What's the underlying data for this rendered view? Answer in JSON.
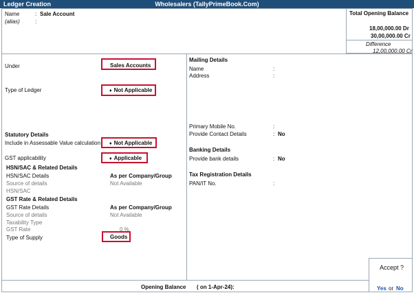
{
  "window": {
    "title": "Ledger Creation",
    "company": "Wholesalers (TallyPrimeBook.Com)"
  },
  "header": {
    "name_label": "Name",
    "name_value": "Sale Account",
    "alias_label": "(alias)"
  },
  "opening_panel": {
    "title": "Total Opening Balance",
    "debit": "18,00,000.00 Dr",
    "credit": "30,00,000.00 Cr",
    "difference_label": "Difference",
    "difference": "12,00,000.00 Cr"
  },
  "left": {
    "under_label": "Under",
    "under_value": "Sales Accounts",
    "type_label": "Type of Ledger",
    "type_value": "Not Applicable",
    "statutory_title": "Statutory Details",
    "assessable_label": "Include in Assessable Value calculation",
    "assessable_value": "Not Applicable",
    "gst_app_label": "GST applicability",
    "gst_app_value": "Applicable",
    "hsn_title": "HSN/SAC & Related Details",
    "hsn_details_label": "HSN/SAC Details",
    "hsn_details_value": "As per Company/Group",
    "hsn_source_label": "Source of details",
    "hsn_source_value": "Not Available",
    "hsn_label": "HSN/SAC",
    "gst_title": "GST Rate & Related Details",
    "gst_details_label": "GST Rate Details",
    "gst_details_value": "As per Company/Group",
    "gst_source_label": "Source of details",
    "gst_source_value": "Not Available",
    "taxability_label": "Taxability Type",
    "gst_rate_label": "GST Rate",
    "gst_rate_value": "0 %",
    "supply_label": "Type of Supply",
    "supply_value": "Goods"
  },
  "right": {
    "mailing_title": "Mailing Details",
    "name_label": "Name",
    "address_label": "Address",
    "mobile_label": "Primary Mobile No.",
    "contact_label": "Provide Contact Details",
    "contact_value": "No",
    "banking_title": "Banking Details",
    "bank_label": "Provide bank details",
    "bank_value": "No",
    "tax_title": "Tax Registration Details",
    "pan_label": "PAN/IT No."
  },
  "footer": {
    "opening_label": "Opening Balance",
    "opening_date": "( on 1-Apr-24)",
    "colon": ":"
  },
  "accept_dialog": {
    "question": "Accept ?",
    "yes": "Yes",
    "or": "or",
    "no": "No"
  },
  "punct": {
    "colon": ":"
  },
  "icons": {
    "diamond": "♦"
  },
  "colors": {
    "titlebar": "#1f4e79",
    "highlight": "#c8102e",
    "accent": "#1a56a8"
  }
}
